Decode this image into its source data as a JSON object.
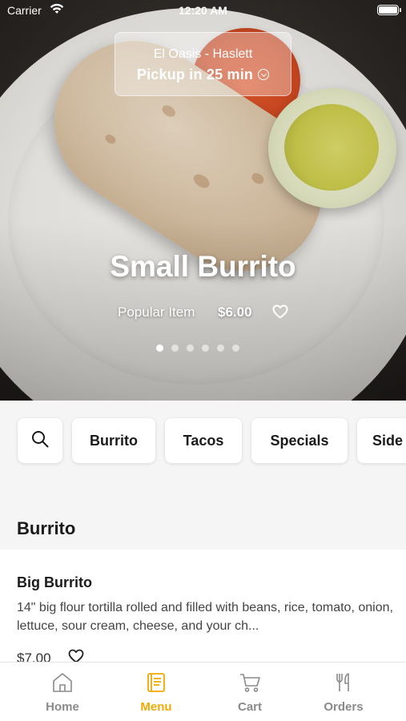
{
  "status_bar": {
    "carrier": "Carrier",
    "time": "12:20 AM",
    "wifi_icon": "wifi-icon",
    "battery_icon": "battery-icon"
  },
  "location": {
    "name": "El Oasis - Haslett",
    "pickup": "Pickup in 25 min"
  },
  "hero": {
    "title": "Small Burrito",
    "subtitle": "Popular Item",
    "price": "$6.00",
    "carousel_count": 6,
    "active_index": 0
  },
  "categories": {
    "search_icon": "search-icon",
    "items": [
      "Burrito",
      "Tacos",
      "Specials",
      "Side"
    ]
  },
  "section": {
    "title": "Burrito",
    "items": [
      {
        "name": "Big Burrito",
        "description": "14\" big flour tortilla rolled and filled with beans, rice, tomato, onion, lettuce, sour cream, cheese, and your ch...",
        "price": "$7.00"
      }
    ]
  },
  "tabbar": {
    "active": "Menu",
    "colors": {
      "active": "#f2a900",
      "inactive": "#8a8a8a"
    },
    "tabs": [
      {
        "label": "Home",
        "icon": "home-icon"
      },
      {
        "label": "Menu",
        "icon": "menu-book-icon"
      },
      {
        "label": "Cart",
        "icon": "cart-icon"
      },
      {
        "label": "Orders",
        "icon": "fork-knife-icon"
      }
    ]
  }
}
